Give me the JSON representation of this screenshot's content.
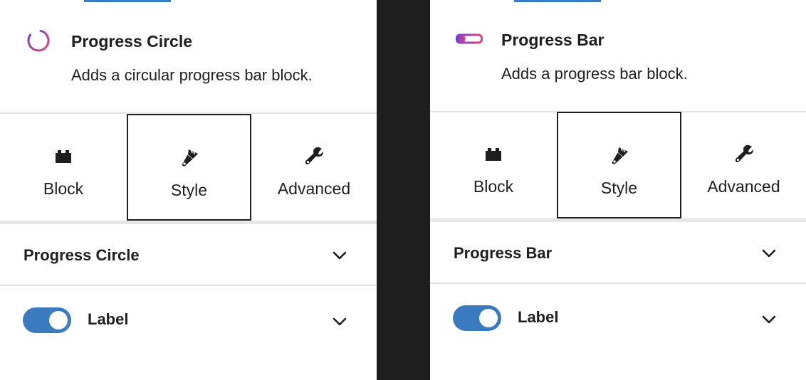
{
  "panels": [
    {
      "block": {
        "icon": "progress-circle-icon",
        "title": "Progress Circle",
        "description": "Adds a circular progress bar block."
      },
      "tabs": [
        {
          "label": "Block",
          "icon": "block-icon"
        },
        {
          "label": "Style",
          "icon": "brush-icon",
          "selected": true
        },
        {
          "label": "Advanced",
          "icon": "wrench-icon"
        }
      ],
      "sections": {
        "settings_title": "Progress Circle",
        "label_toggle": {
          "label": "Label",
          "enabled": true
        }
      }
    },
    {
      "block": {
        "icon": "progress-bar-icon",
        "title": "Progress Bar",
        "description": "Adds a progress bar block."
      },
      "tabs": [
        {
          "label": "Block",
          "icon": "block-icon"
        },
        {
          "label": "Style",
          "icon": "brush-icon",
          "selected": true
        },
        {
          "label": "Advanced",
          "icon": "wrench-icon"
        }
      ],
      "sections": {
        "settings_title": "Progress Bar",
        "label_toggle": {
          "label": "Label",
          "enabled": true
        }
      }
    }
  ],
  "colors": {
    "accent": "#3a7abf",
    "gradient_start": "#c23d8f",
    "gradient_end": "#6b3fd6",
    "text": "#1e1e1e",
    "divider": "#e2e2e2"
  }
}
